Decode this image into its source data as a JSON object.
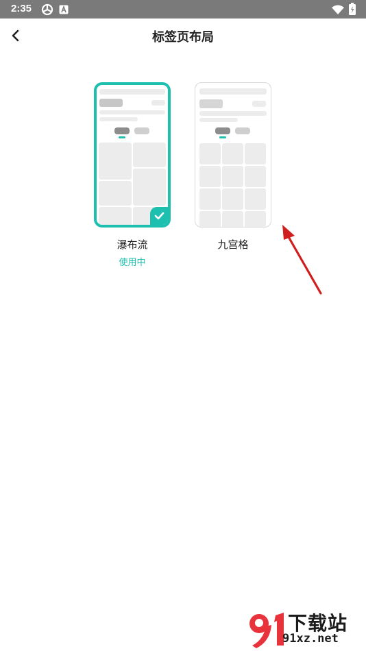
{
  "status_bar": {
    "time": "2:35",
    "icons": [
      "sync-icon",
      "a-icon",
      "wifi-icon",
      "battery-icon"
    ],
    "bg_color": "#7a7a7a"
  },
  "header": {
    "title": "标签页布局",
    "back_icon": "back-chevron-icon"
  },
  "layouts": [
    {
      "label": "瀑布流",
      "status": "使用中",
      "selected": true
    },
    {
      "label": "九宫格",
      "status": "",
      "selected": false
    }
  ],
  "accent_color": "#1dbfae",
  "watermark": {
    "logo_text": "91",
    "brand": "下载站",
    "url": "91xz.net"
  }
}
